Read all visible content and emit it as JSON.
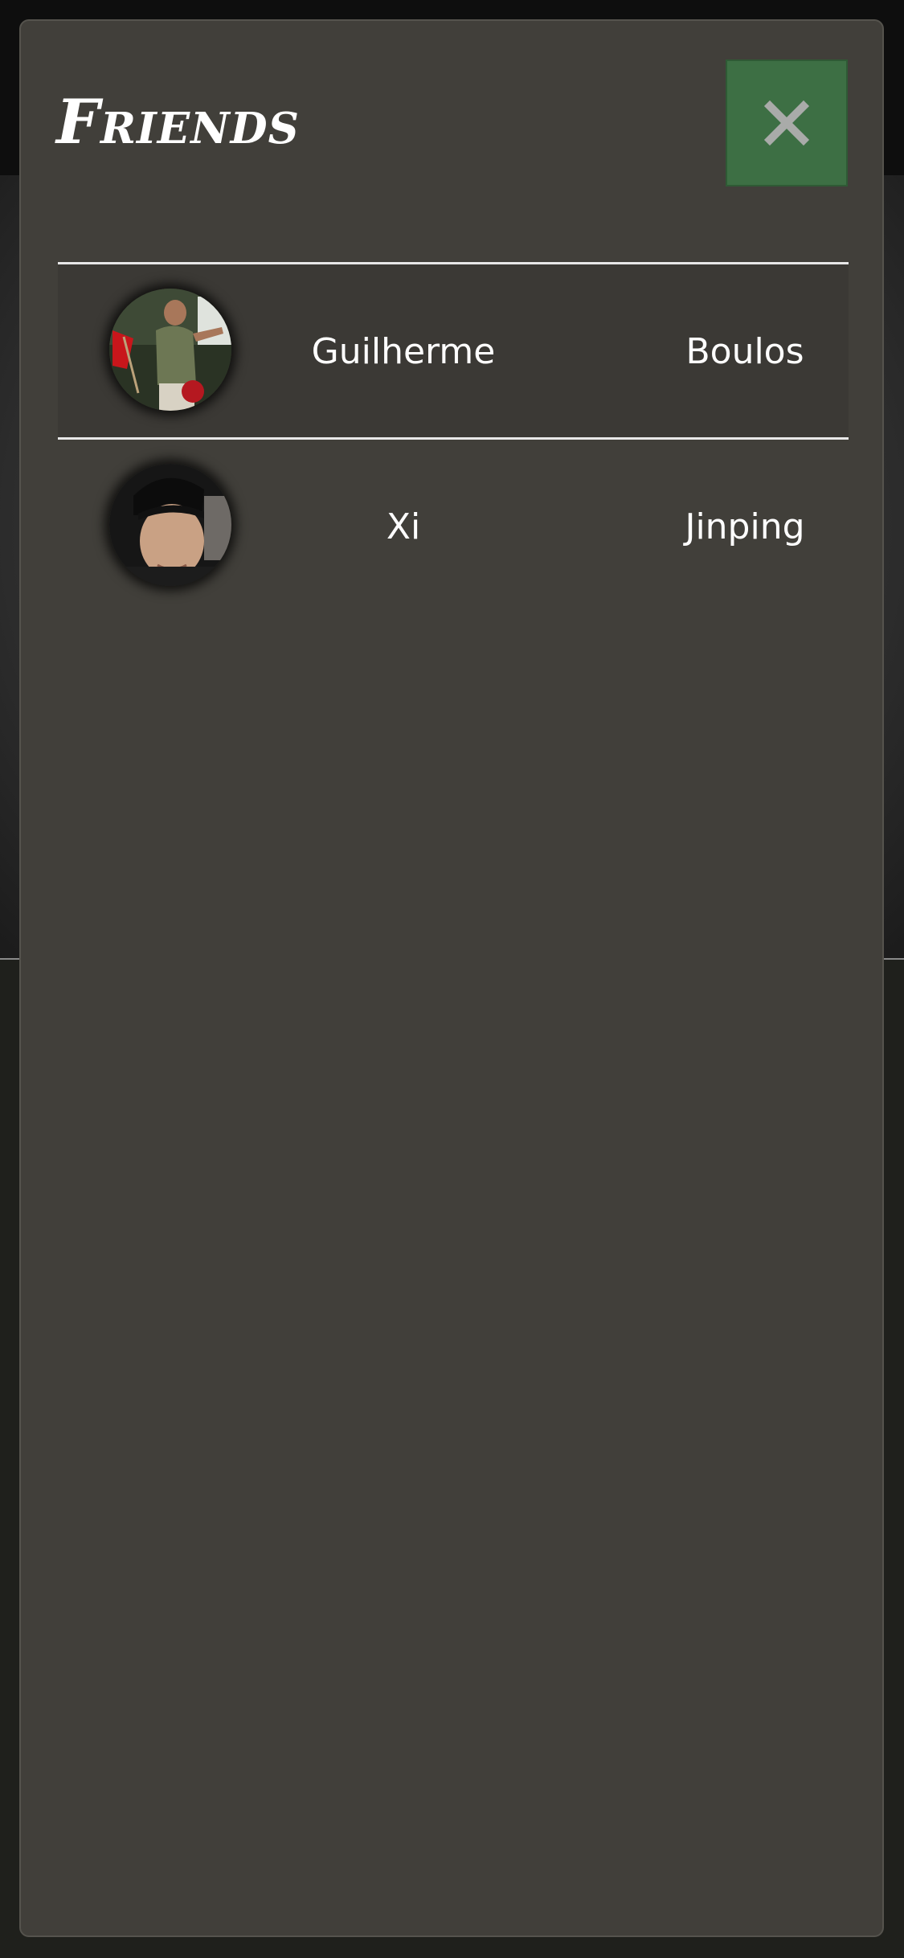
{
  "modal": {
    "title": "Friends",
    "close_label": "×"
  },
  "friends": [
    {
      "first_name": "Guilherme",
      "last_name": "Boulos"
    },
    {
      "first_name": "Xi",
      "last_name": "Jinping"
    }
  ],
  "colors": {
    "modal_bg": "#413f3a",
    "close_button_bg": "#3d6f44",
    "text": "#ffffff"
  }
}
